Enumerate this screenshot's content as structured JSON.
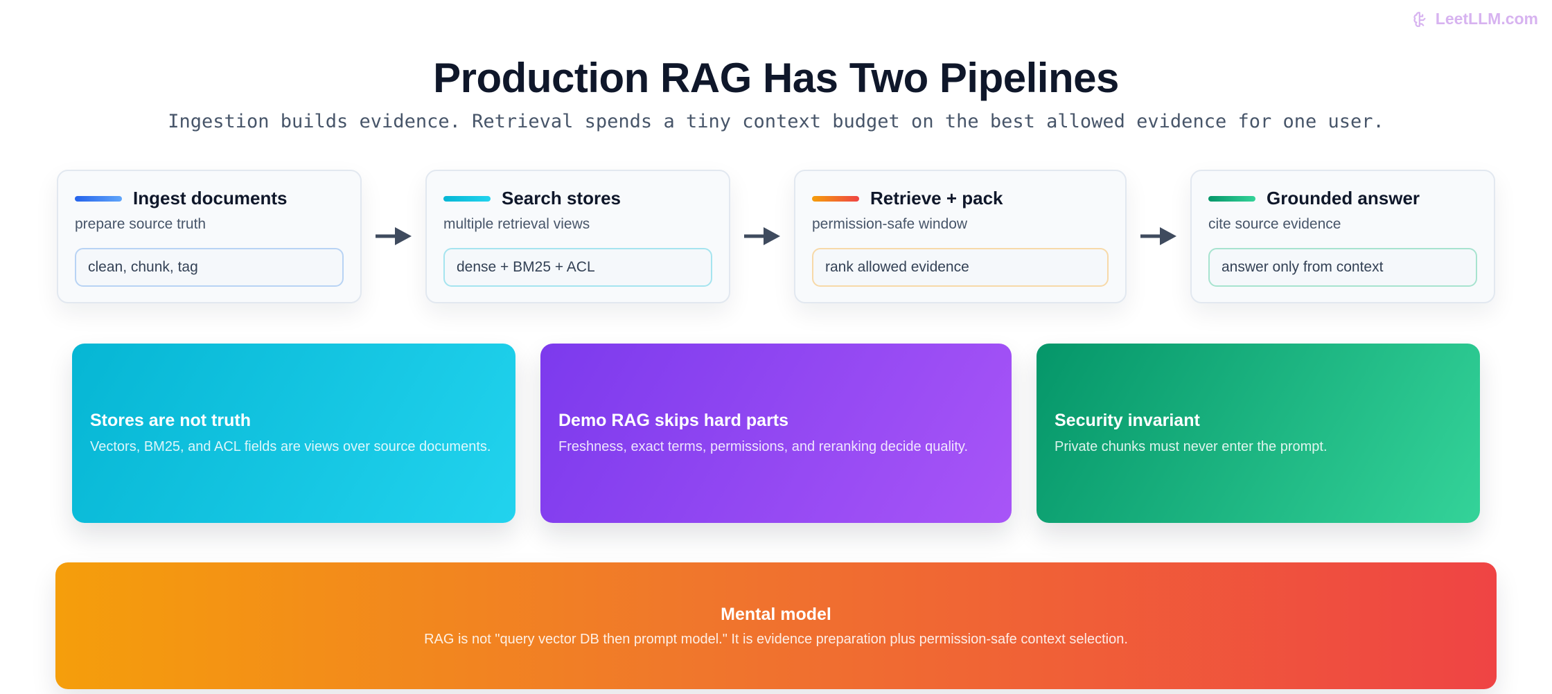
{
  "brand": {
    "label": "LeetLLM.com"
  },
  "header": {
    "title": "Production RAG Has Two Pipelines",
    "subtitle": "Ingestion builds evidence. Retrieval spends a tiny context budget on the best allowed evidence for one user."
  },
  "steps": [
    {
      "title": "Ingest documents",
      "subtitle": "prepare source truth",
      "chip": "clean, chunk, tag",
      "accent": "#3b82f6",
      "chip_border": "#b8d3f4"
    },
    {
      "title": "Search stores",
      "subtitle": "multiple retrieval views",
      "chip": "dense + BM25 + ACL",
      "accent": "#06b6d4",
      "chip_border": "#a5e4ef"
    },
    {
      "title": "Retrieve + pack",
      "subtitle": "permission-safe window",
      "chip": "rank allowed evidence",
      "accent": "#f97316",
      "chip_border": "#f7d9a8"
    },
    {
      "title": "Grounded answer",
      "subtitle": "cite source evidence",
      "chip": "answer only from context",
      "accent": "#10b981",
      "chip_border": "#a7e3cf"
    }
  ],
  "cards": [
    {
      "title": "Stores are not truth",
      "body": "Vectors, BM25, and ACL fields are views over source documents.",
      "gradient": [
        "#06b6d4",
        "#22d3ee"
      ]
    },
    {
      "title": "Demo RAG skips hard parts",
      "body": "Freshness, exact terms, permissions, and reranking decide quality.",
      "gradient": [
        "#7c3aed",
        "#a855f7"
      ]
    },
    {
      "title": "Security invariant",
      "body": "Private chunks must never enter the prompt.",
      "gradient": [
        "#059669",
        "#34d399"
      ]
    }
  ],
  "summary": {
    "title": "Mental model",
    "body": "RAG is not \"query vector DB then prompt model.\" It is evidence preparation plus permission-safe context selection.",
    "gradient": [
      "#f59e0b",
      "#ef4444"
    ]
  },
  "icons": {
    "brand": "brain-icon",
    "flow": "arrow-right-icon"
  }
}
